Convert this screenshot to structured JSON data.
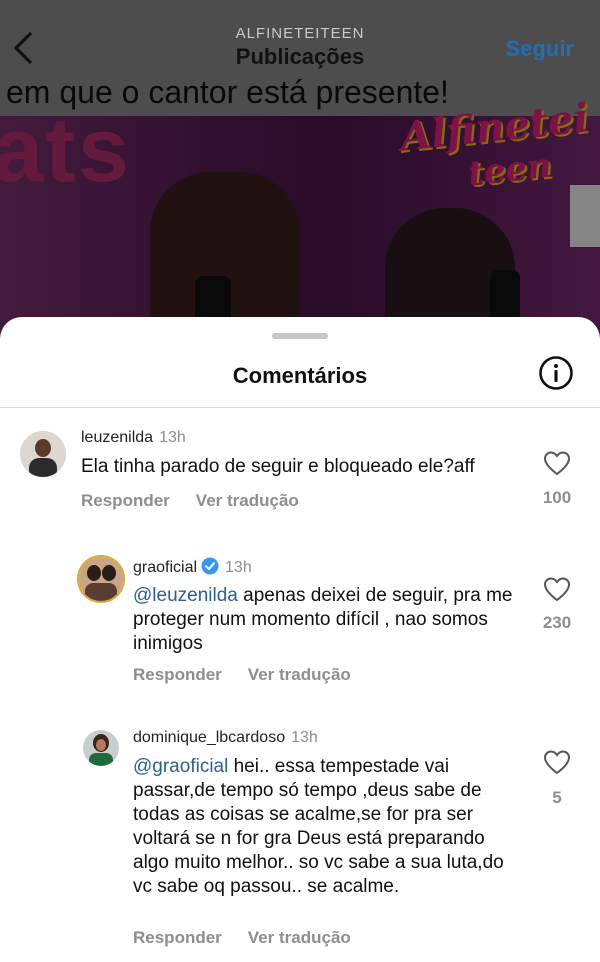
{
  "header": {
    "account": "ALFINETEITEEN",
    "title": "Publicações",
    "follow_label": "Seguir"
  },
  "post": {
    "caption": "em que o cantor está presente!",
    "logo_line1": "Alfinetei",
    "logo_line2": "teen"
  },
  "comments_sheet": {
    "title": "Comentários",
    "comments": [
      {
        "username": "leuzenilda",
        "time": "13h",
        "mention": "",
        "text": "Ela tinha parado de seguir e bloqueado ele?aff",
        "reply_label": "Responder",
        "translate_label": "Ver tradução",
        "likes": "100"
      },
      {
        "username": "graoficial",
        "time": "13h",
        "verified": true,
        "mention": "@leuzenilda",
        "text": " apenas deixei de seguir, pra me proteger num momento difícil , nao somos inimigos",
        "reply_label": "Responder",
        "translate_label": "Ver tradução",
        "likes": "230"
      },
      {
        "username": "dominique_lbcardoso",
        "time": "13h",
        "mention": "@graoficial",
        "text": " hei.. essa tempestade vai passar,de tempo só tempo ,deus sabe de todas as coisas se acalme,se for pra ser voltará se n for gra Deus está preparando algo muito melhor.. so vc sabe a sua luta,do vc sabe oq passou.. se acalme.",
        "reply_label": "Responder",
        "translate_label": "Ver tradução",
        "likes": "5"
      }
    ]
  },
  "colors": {
    "accent": "#1f6fb8",
    "mention": "#2d5f8f",
    "muted": "#8e8e8e",
    "verified": "#3897f0"
  }
}
